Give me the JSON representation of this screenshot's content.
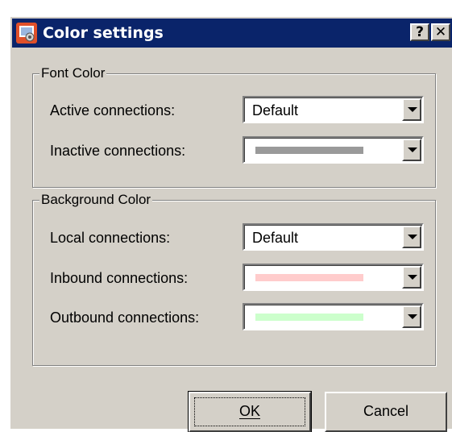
{
  "window": {
    "title": "Color settings",
    "help_button": "?",
    "close_button": "✕",
    "icon": "app-settings-icon"
  },
  "font_color": {
    "legend": "Font Color",
    "rows": [
      {
        "label": "Active connections:",
        "value": "Default"
      },
      {
        "label": "Inactive connections:",
        "swatch": "#9a9a9a"
      }
    ]
  },
  "background_color": {
    "legend": "Background Color",
    "rows": [
      {
        "label": "Local connections:",
        "value": "Default"
      },
      {
        "label": "Inbound connections:",
        "swatch": "#ffcccc"
      },
      {
        "label": "Outbound connections:",
        "swatch": "#ccffcc"
      }
    ]
  },
  "buttons": {
    "ok": "OK",
    "cancel": "Cancel"
  },
  "colors": {
    "titlebar": "#0a246a",
    "dialog": "#d4d0c8"
  }
}
